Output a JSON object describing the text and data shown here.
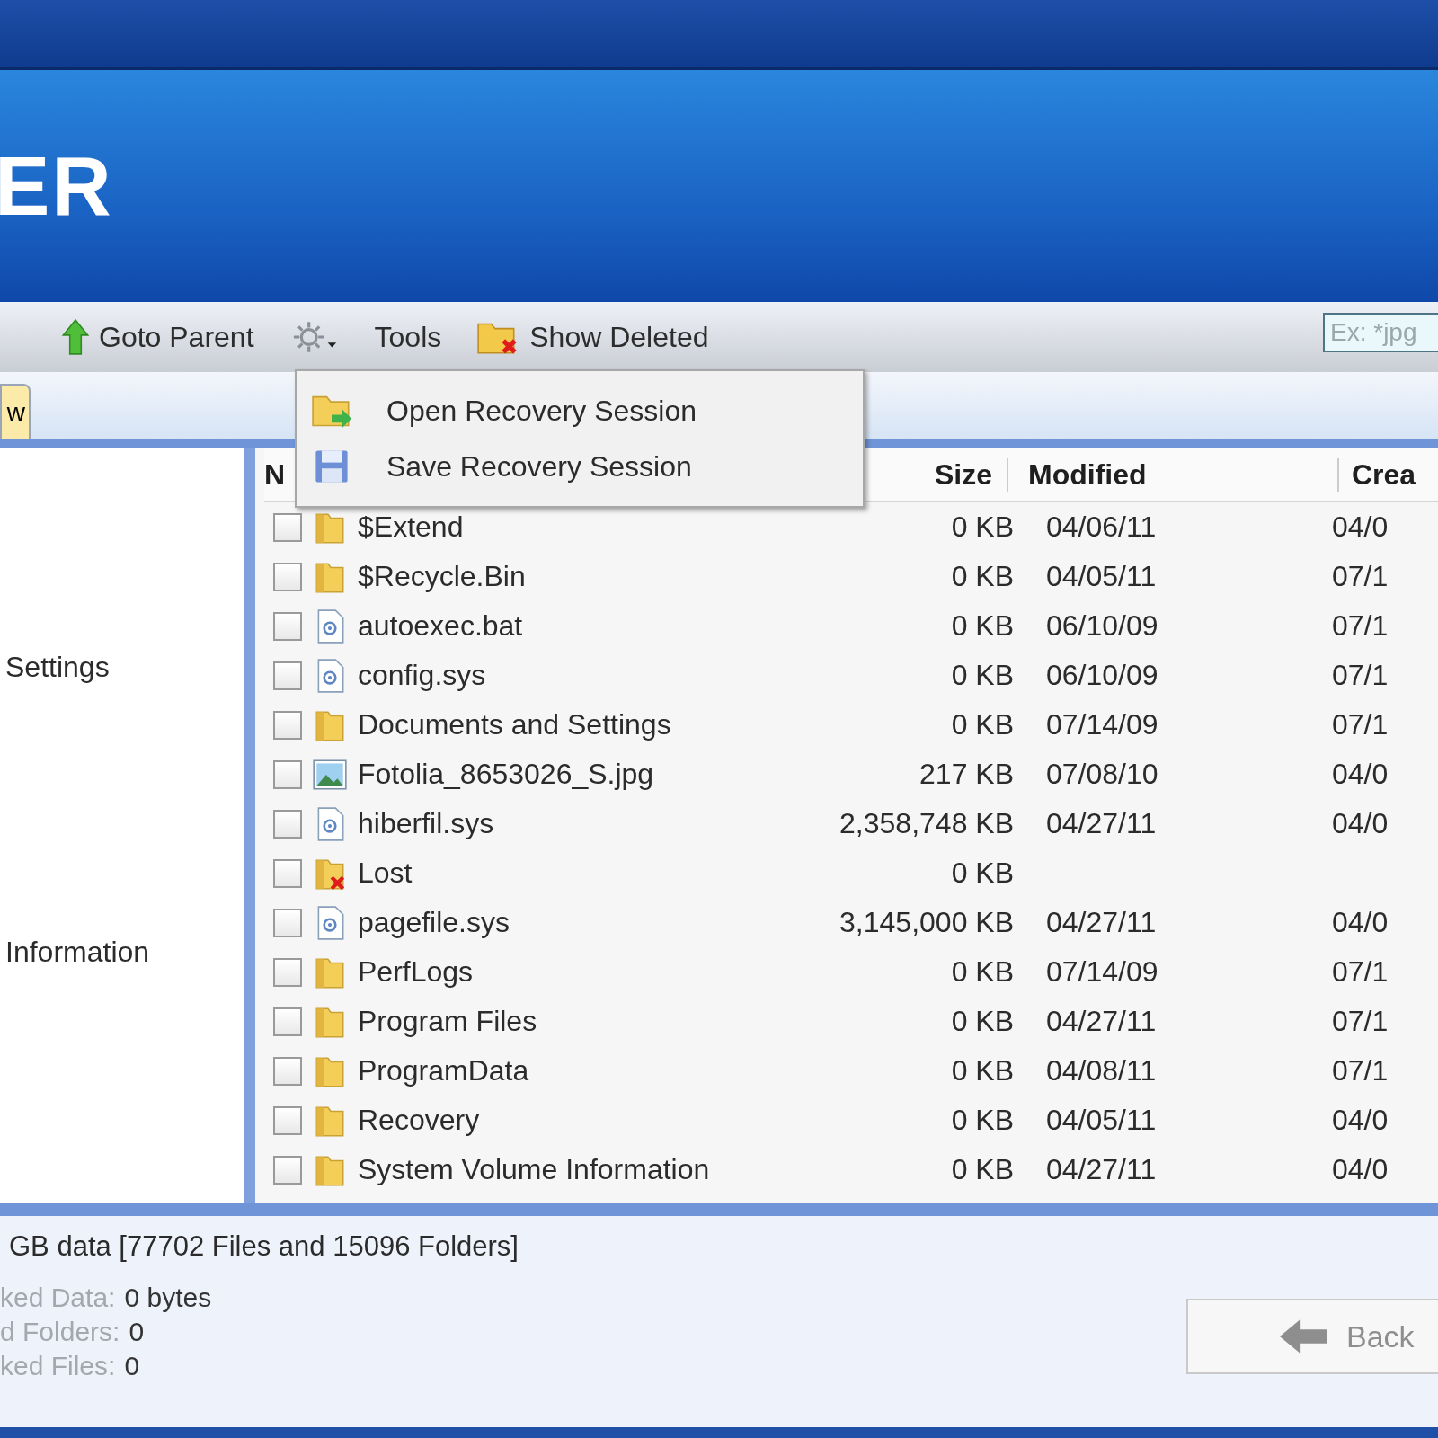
{
  "header": {
    "logo": "ER"
  },
  "toolbar": {
    "items": [
      {
        "kind": "parent",
        "label": "Goto Parent"
      },
      {
        "kind": "gear"
      },
      {
        "kind": "tools",
        "label": "Tools"
      },
      {
        "kind": "deleted",
        "label": "Show Deleted"
      }
    ],
    "search": {
      "placeholder": "Ex: *jpg"
    }
  },
  "tools_menu": {
    "open": true,
    "items": [
      {
        "kind": "open",
        "label": "Open Recovery Session"
      },
      {
        "kind": "save",
        "label": "Save Recovery Session"
      }
    ]
  },
  "tabs": [
    {
      "label": "w",
      "selected": true
    }
  ],
  "sidebar": {
    "items": [
      "Settings",
      "Information"
    ]
  },
  "table": {
    "columns": [
      "N",
      "Size",
      "Modified",
      "Crea"
    ],
    "rows": [
      {
        "kind": "folder",
        "checked": false,
        "name": "$Extend",
        "size": "0 KB",
        "modified": "04/06/11",
        "created": "04/0"
      },
      {
        "kind": "folder",
        "checked": false,
        "name": "$Recycle.Bin",
        "size": "0 KB",
        "modified": "04/05/11",
        "created": "07/1"
      },
      {
        "kind": "file",
        "checked": false,
        "name": "autoexec.bat",
        "size": "0 KB",
        "modified": "06/10/09",
        "created": "07/1"
      },
      {
        "kind": "file",
        "checked": false,
        "name": "config.sys",
        "size": "0 KB",
        "modified": "06/10/09",
        "created": "07/1"
      },
      {
        "kind": "folder",
        "checked": false,
        "name": "Documents and Settings",
        "size": "0 KB",
        "modified": "07/14/09",
        "created": "07/1"
      },
      {
        "kind": "image",
        "checked": false,
        "name": "Fotolia_8653026_S.jpg",
        "size": "217 KB",
        "modified": "07/08/10",
        "created": "04/0"
      },
      {
        "kind": "file",
        "checked": false,
        "name": "hiberfil.sys",
        "size": "2,358,748 KB",
        "modified": "04/27/11",
        "created": "04/0"
      },
      {
        "kind": "deleted-folder",
        "checked": false,
        "name": "Lost",
        "size": "0 KB"
      },
      {
        "kind": "file",
        "checked": false,
        "name": "pagefile.sys",
        "size": "3,145,000 KB",
        "modified": "04/27/11",
        "created": "04/0"
      },
      {
        "kind": "folder",
        "checked": false,
        "name": "PerfLogs",
        "size": "0 KB",
        "modified": "07/14/09",
        "created": "07/1"
      },
      {
        "kind": "folder",
        "checked": false,
        "name": "Program Files",
        "size": "0 KB",
        "modified": "04/27/11",
        "created": "07/1"
      },
      {
        "kind": "folder",
        "checked": false,
        "name": "ProgramData",
        "size": "0 KB",
        "modified": "04/08/11",
        "created": "07/1"
      },
      {
        "kind": "folder",
        "checked": false,
        "name": "Recovery",
        "size": "0 KB",
        "modified": "04/05/11",
        "created": "04/0"
      },
      {
        "kind": "folder",
        "checked": false,
        "name": "System Volume Information",
        "size": "0 KB",
        "modified": "04/27/11",
        "created": "04/0"
      }
    ]
  },
  "summary": {
    "text": "GB data [77702 Files and 15096 Folders]",
    "stats": [
      {
        "label": "ked Data:",
        "value": "0 bytes"
      },
      {
        "label": "d Folders:",
        "value": "0"
      },
      {
        "label": "ked Files:",
        "value": "0"
      }
    ]
  },
  "back_button": {
    "label": "Back",
    "disabled": true
  }
}
